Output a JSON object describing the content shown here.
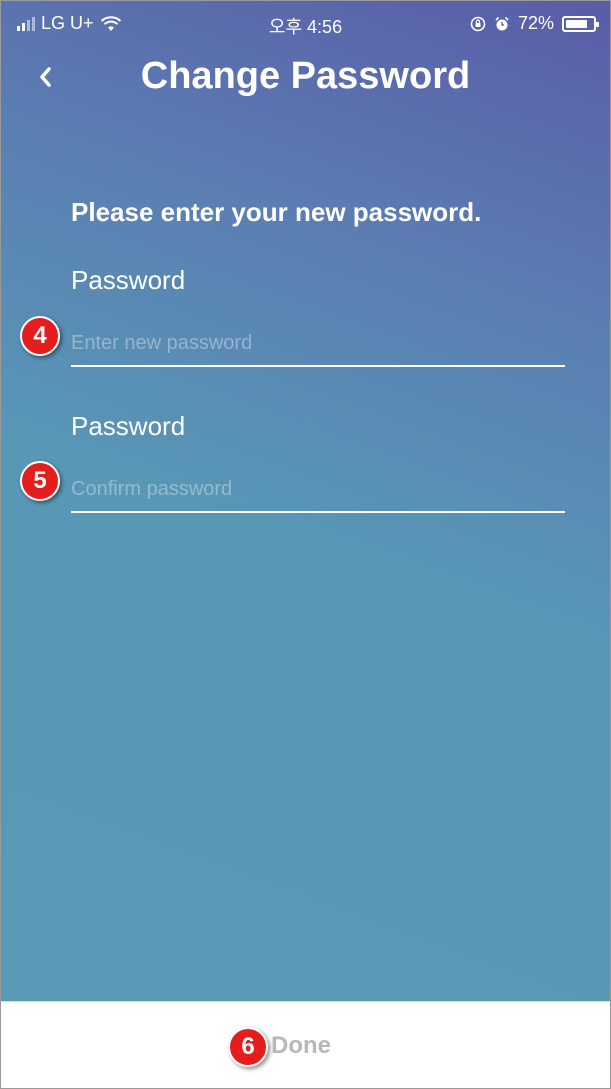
{
  "status_bar": {
    "carrier": "LG U+",
    "time": "오후 4:56",
    "battery": "72%",
    "battery_level": 0.72,
    "icons": [
      "signal-icon",
      "wifi-icon",
      "rotation-lock-icon",
      "alarm-icon",
      "battery-icon"
    ]
  },
  "header": {
    "back_icon": "chevron-left-icon",
    "title": "Change Password"
  },
  "form": {
    "prompt": "Please enter your new password.",
    "fields": [
      {
        "label": "Password",
        "placeholder": "Enter new password",
        "value": "",
        "badge": "4"
      },
      {
        "label": "Password",
        "placeholder": "Confirm password",
        "value": "",
        "badge": "5"
      }
    ]
  },
  "footer": {
    "done_label": "Done",
    "badge": "6"
  },
  "colors": {
    "gradient_top": "#5a5ca8",
    "gradient_bottom": "#5899b5",
    "badge": "#e41d1d",
    "done_text": "#b8b8b8"
  }
}
